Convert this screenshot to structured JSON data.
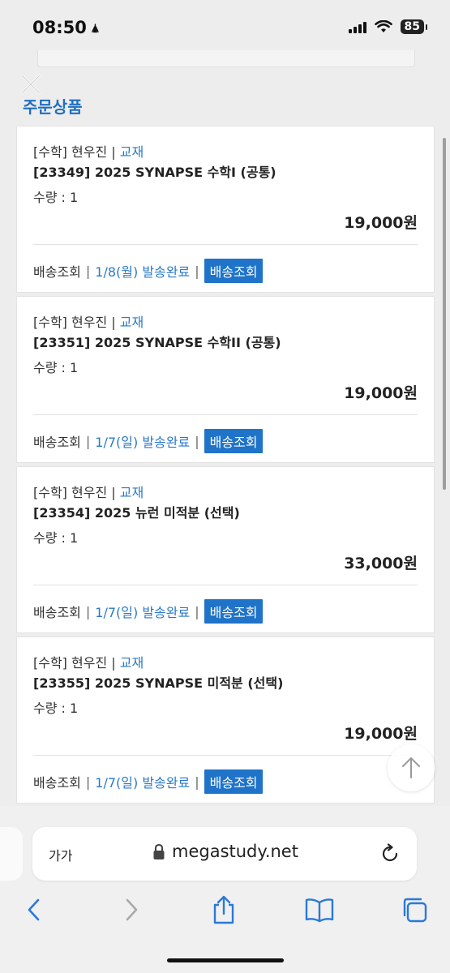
{
  "status": {
    "time": "08:50",
    "time_glyph": "🛦",
    "battery": "85"
  },
  "section_title": "주문상품",
  "orders": [
    {
      "category": "[수학]",
      "teacher": "현우진",
      "sep": "|",
      "type_link": "교재",
      "title": "[23349] 2025 SYNAPSE 수학I (공통)",
      "quantity": "수량 : 1",
      "price": "19,000원",
      "ship_label": "배송조회",
      "ship_date": "1/8(월) 발송완료",
      "ship_button": "배송조회"
    },
    {
      "category": "[수학]",
      "teacher": "현우진",
      "sep": "|",
      "type_link": "교재",
      "title": "[23351] 2025 SYNAPSE 수학II (공통)",
      "quantity": "수량 : 1",
      "price": "19,000원",
      "ship_label": "배송조회",
      "ship_date": "1/7(일) 발송완료",
      "ship_button": "배송조회"
    },
    {
      "category": "[수학]",
      "teacher": "현우진",
      "sep": "|",
      "type_link": "교재",
      "title": "[23354] 2025 뉴런 미적분 (선택)",
      "quantity": "수량 : 1",
      "price": "33,000원",
      "ship_label": "배송조회",
      "ship_date": "1/7(일) 발송완료",
      "ship_button": "배송조회"
    },
    {
      "category": "[수학]",
      "teacher": "현우진",
      "sep": "|",
      "type_link": "교재",
      "title": "[23355] 2025 SYNAPSE 미적분 (선택)",
      "quantity": "수량 : 1",
      "price": "19,000원",
      "ship_label": "배송조회",
      "ship_date": "1/7(일) 발송완료",
      "ship_button": "배송조회"
    }
  ],
  "browser": {
    "text_size_label": "가가",
    "url": "megastudy.net"
  },
  "icons": {
    "close": "close-icon",
    "scroll_top": "arrow-up-icon",
    "lock": "lock-icon",
    "reload": "reload-icon",
    "back": "chevron-left-icon",
    "forward": "chevron-right-icon",
    "share": "share-icon",
    "bookmarks": "book-icon",
    "tabs": "tabs-icon"
  },
  "colors": {
    "accent": "#1f73c8",
    "link": "#2a79c8",
    "title": "#1f6fc0"
  }
}
